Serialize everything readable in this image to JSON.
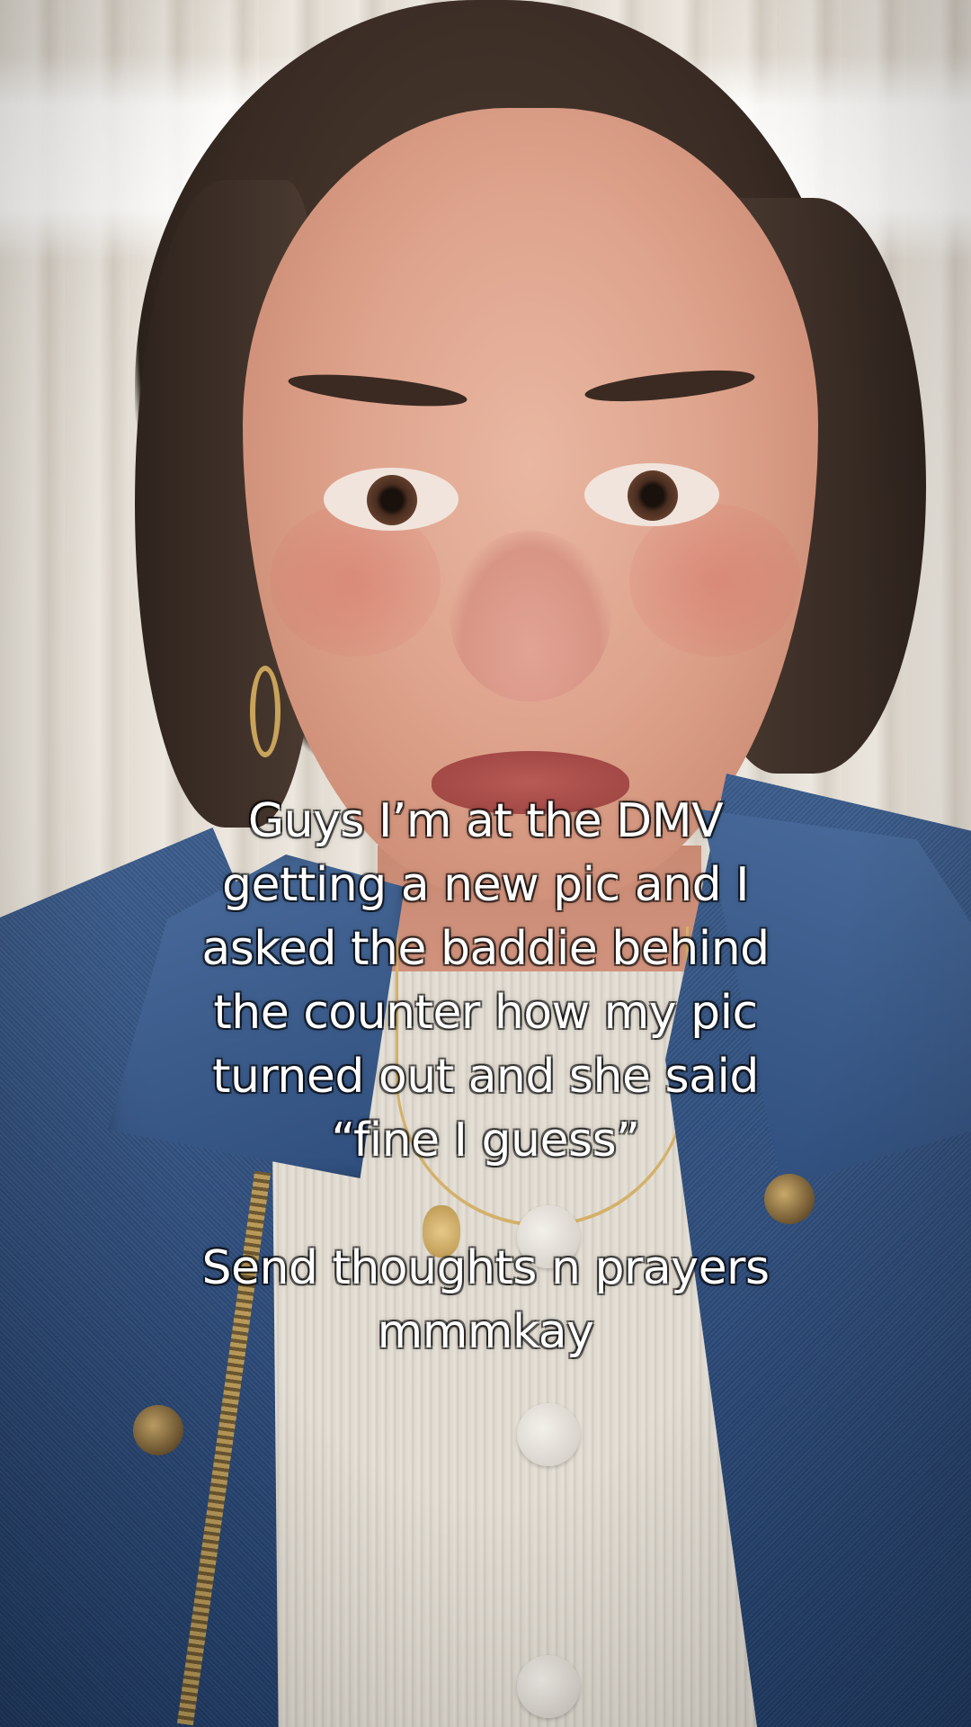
{
  "caption": {
    "lines": [
      "Guys I’m at the DMV",
      "getting a new pic and I",
      "asked the baddie behind",
      "the counter how my pic",
      "turned out and she said",
      "“fine I guess”"
    ],
    "lines_after_break": [
      "Send thoughts n prayers",
      "mmmkay"
    ]
  },
  "photo": {
    "subject": "selfie-portrait",
    "palette": {
      "denim": "#2c4a78",
      "skin": "#dea38c",
      "hair": "#3a2c24",
      "background": "#e6e0d7",
      "caption_text": "#ffffff"
    }
  }
}
